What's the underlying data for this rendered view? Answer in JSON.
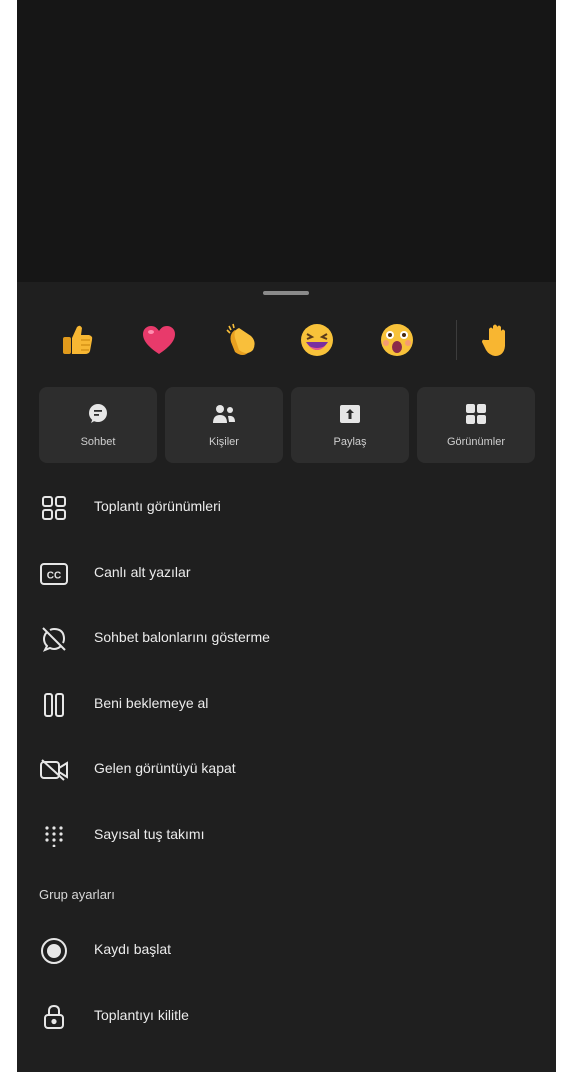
{
  "reactions": [
    {
      "name": "thumbs-up-emoji"
    },
    {
      "name": "heart-emoji"
    },
    {
      "name": "clapping-hands-emoji"
    },
    {
      "name": "laughing-face-emoji"
    },
    {
      "name": "surprised-face-emoji"
    },
    {
      "name": "raise-hand-emoji"
    }
  ],
  "tiles": [
    {
      "label": "Sohbet",
      "icon": "chat-icon"
    },
    {
      "label": "Kişiler",
      "icon": "people-icon"
    },
    {
      "label": "Paylaş",
      "icon": "share-icon"
    },
    {
      "label": "Görünümler",
      "icon": "views-icon"
    }
  ],
  "menu": {
    "items": [
      {
        "label": "Toplantı görünümleri",
        "icon": "grid-layout-icon"
      },
      {
        "label": "Canlı alt yazılar",
        "icon": "closed-captions-icon"
      },
      {
        "label": "Sohbet balonlarını gösterme",
        "icon": "chat-bubbles-off-icon"
      },
      {
        "label": "Beni beklemeye al",
        "icon": "pause-icon"
      },
      {
        "label": "Gelen görüntüyü kapat",
        "icon": "video-off-icon"
      },
      {
        "label": "Sayısal tuş takımı",
        "icon": "dialpad-icon"
      }
    ],
    "group_title": "Grup ayarları",
    "group_items": [
      {
        "label": "Kaydı başlat",
        "icon": "record-icon"
      },
      {
        "label": "Toplantıyı kilitle",
        "icon": "lock-icon"
      }
    ]
  },
  "colors": {
    "background": "#1b1b1b",
    "sheet": "#1f1f1f",
    "tile": "#2d2d2d",
    "text": "#ececec",
    "icon": "#e6e6e6"
  }
}
